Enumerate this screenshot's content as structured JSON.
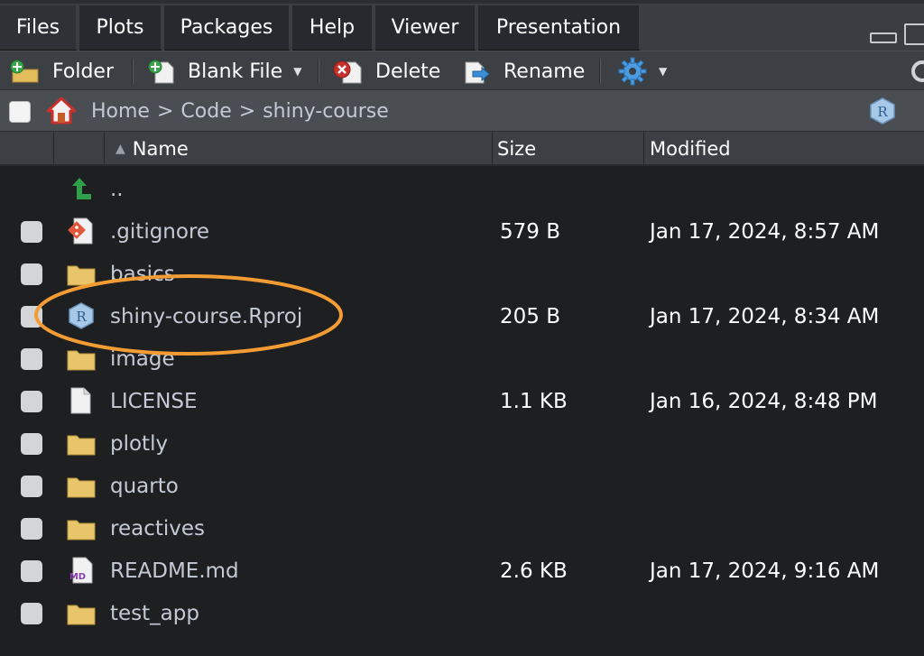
{
  "tabs": [
    {
      "label": "Files",
      "active": true
    },
    {
      "label": "Plots"
    },
    {
      "label": "Packages"
    },
    {
      "label": "Help"
    },
    {
      "label": "Viewer"
    },
    {
      "label": "Presentation"
    }
  ],
  "toolbar": {
    "folder_label": "Folder",
    "blank_file_label": "Blank File",
    "delete_label": "Delete",
    "rename_label": "Rename"
  },
  "breadcrumb": {
    "home": "Home",
    "sep": ">",
    "code": "Code",
    "current": "shiny-course"
  },
  "columns": {
    "name": "Name",
    "size": "Size",
    "modified": "Modified"
  },
  "files": [
    {
      "name": "..",
      "size": "",
      "modified": "",
      "icon": "parent-dir-icon"
    },
    {
      "name": ".gitignore",
      "size": "579 B",
      "modified": "Jan 17, 2024, 8:57 AM",
      "icon": "git-file-icon"
    },
    {
      "name": "basics",
      "size": "",
      "modified": "",
      "icon": "folder-icon"
    },
    {
      "name": "shiny-course.Rproj",
      "size": "205 B",
      "modified": "Jan 17, 2024, 8:34 AM",
      "icon": "rproj-icon"
    },
    {
      "name": "image",
      "size": "",
      "modified": "",
      "icon": "folder-icon"
    },
    {
      "name": "LICENSE",
      "size": "1.1 KB",
      "modified": "Jan 16, 2024, 8:48 PM",
      "icon": "text-file-icon"
    },
    {
      "name": "plotly",
      "size": "",
      "modified": "",
      "icon": "folder-icon"
    },
    {
      "name": "quarto",
      "size": "",
      "modified": "",
      "icon": "folder-icon"
    },
    {
      "name": "reactives",
      "size": "",
      "modified": "",
      "icon": "folder-icon"
    },
    {
      "name": "README.md",
      "size": "2.6 KB",
      "modified": "Jan 17, 2024, 9:16 AM",
      "icon": "markdown-file-icon"
    },
    {
      "name": "test_app",
      "size": "",
      "modified": "",
      "icon": "folder-icon"
    }
  ],
  "colors": {
    "highlight": "#f39c34",
    "folder": "#e8c46a",
    "link_text": "#c4c9d6"
  }
}
